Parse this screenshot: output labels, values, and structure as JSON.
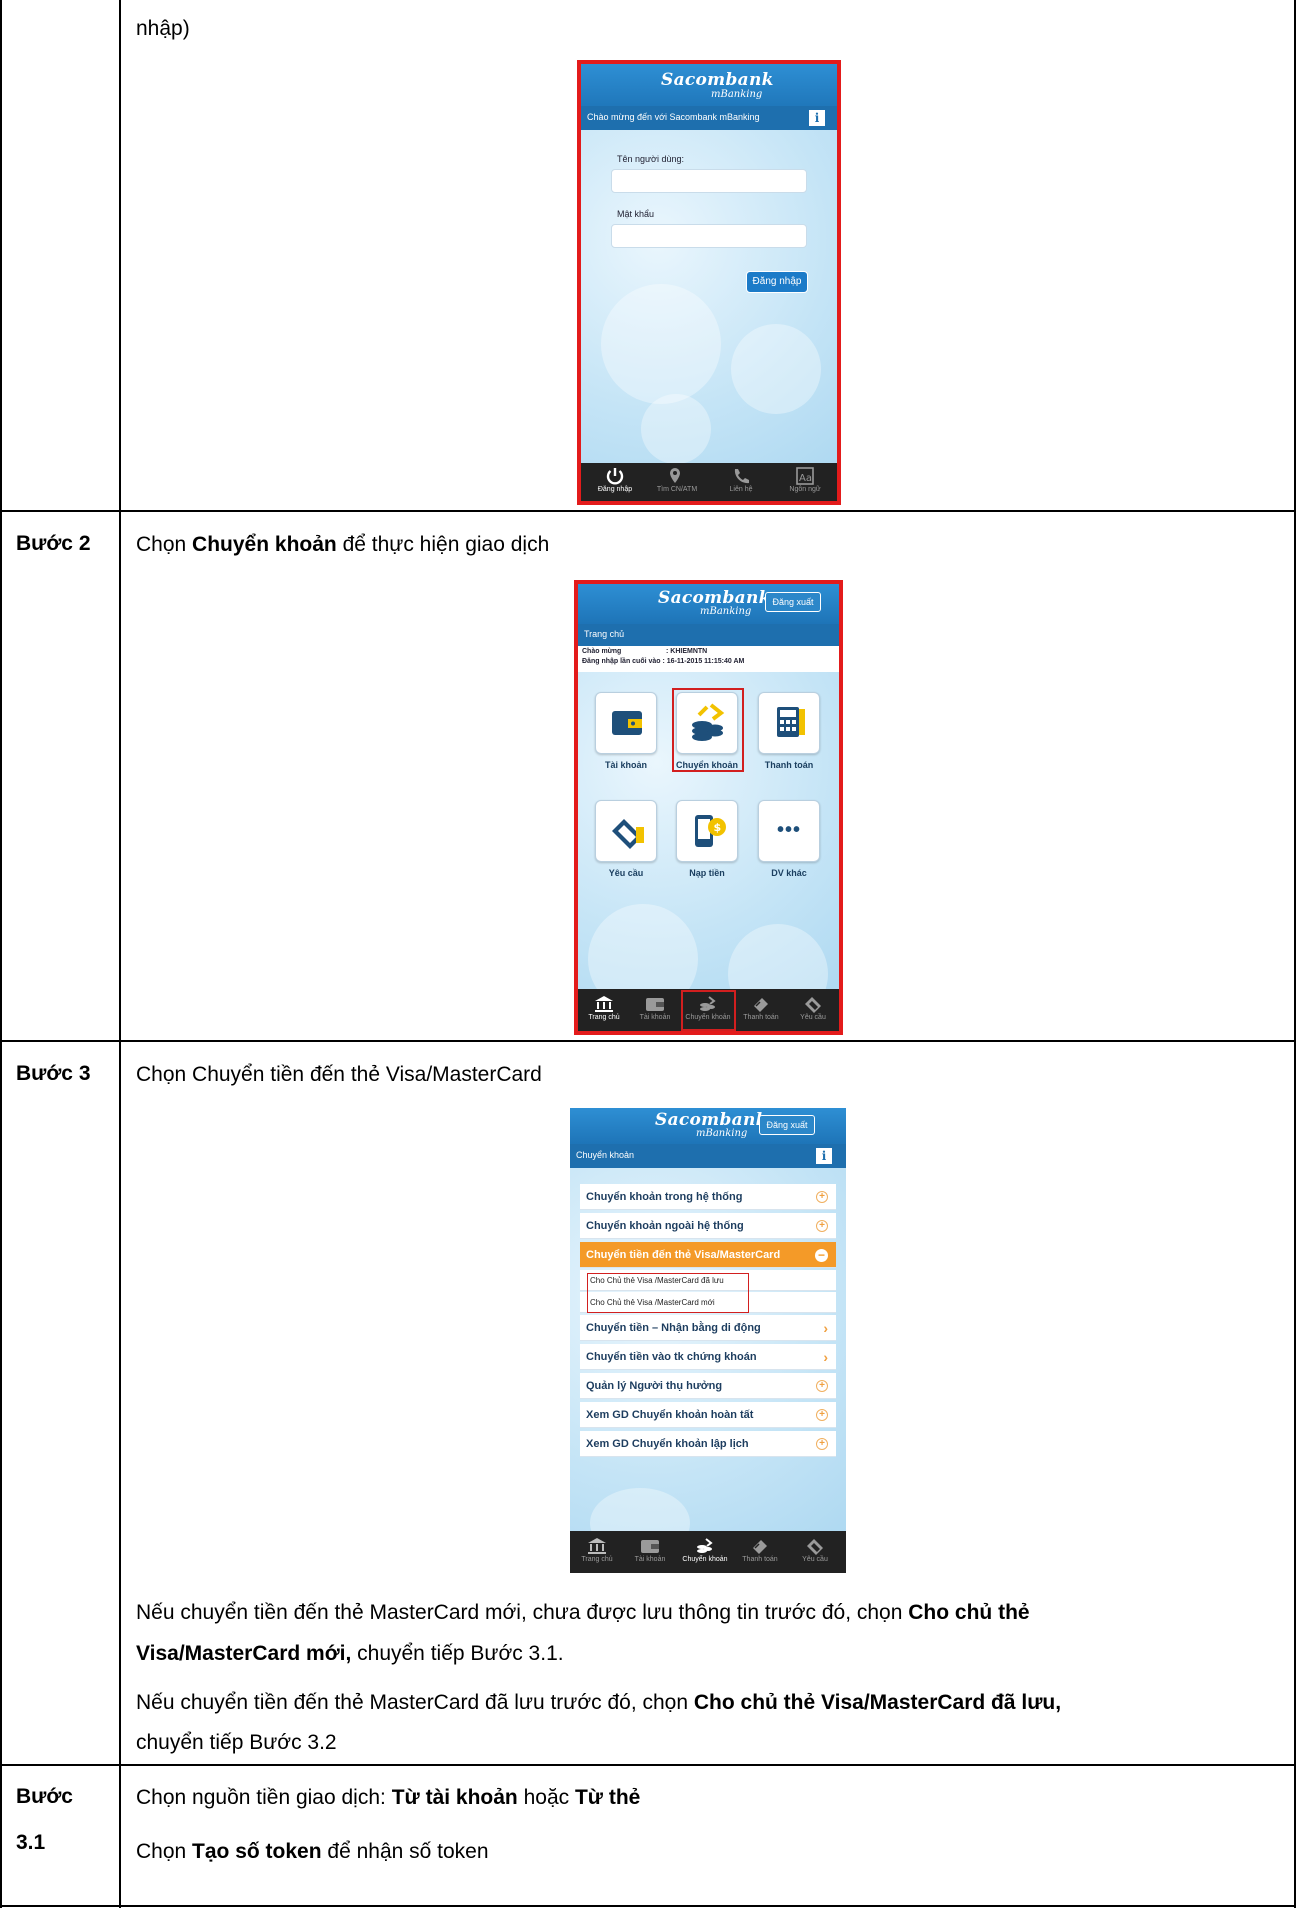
{
  "top_row": {
    "text_prefix": "nhập)",
    "phone": {
      "brand": "Sacombank",
      "brand_sub": "mBanking",
      "welcome_bar": "Chào mừng đến với Sacombank mBanking",
      "info_icon": "i",
      "username_label": "Tên người dùng:",
      "password_label": "Mật khẩu",
      "login_button": "Đăng nhập",
      "tabs": [
        {
          "label": "Đăng nhập",
          "icon": "power-icon"
        },
        {
          "label": "Tìm CN/ATM",
          "icon": "map-pin-icon"
        },
        {
          "label": "Liên hệ",
          "icon": "phone-icon"
        },
        {
          "label": "Ngôn ngữ",
          "icon": "language-icon"
        }
      ]
    }
  },
  "step2": {
    "label": "Bước 2",
    "instruction_prefix": "Chọn ",
    "instruction_bold": "Chuyển khoản",
    "instruction_suffix": " để thực hiện giao dịch",
    "phone": {
      "brand": "Sacombank",
      "brand_sub": "mBanking",
      "logout_button": "Đăng xuất",
      "page_bar": "Trang chủ",
      "greeting_line1": "Chào mừng                       : KHIEMNTN",
      "greeting_line2": "Đăng nhập lần cuối vào : 16-11-2015 11:15:40 AM",
      "tiles": [
        {
          "label": "Tài khoản",
          "icon": "wallet-icon"
        },
        {
          "label": "Chuyển khoản",
          "icon": "coins-transfer-icon"
        },
        {
          "label": "Thanh toán",
          "icon": "calculator-icon"
        },
        {
          "label": "Yêu cầu",
          "icon": "card-request-icon"
        },
        {
          "label": "Nạp tiền",
          "icon": "mobile-topup-icon"
        },
        {
          "label": "DV khác",
          "icon": "more-dots-icon"
        }
      ],
      "more_dots": "•••",
      "tabs": [
        {
          "label": "Trang chủ",
          "icon": "bank-icon"
        },
        {
          "label": "Tài khoản",
          "icon": "wallet-icon"
        },
        {
          "label": "Chuyển khoản",
          "icon": "transfer-icon"
        },
        {
          "label": "Thanh toán",
          "icon": "payment-icon"
        },
        {
          "label": "Yêu cầu",
          "icon": "request-icon"
        }
      ]
    }
  },
  "step3": {
    "label": "Bước 3",
    "instruction": "Chọn Chuyển tiền đến thẻ Visa/MasterCard",
    "phone": {
      "brand": "Sacombank",
      "brand_sub": "mBanking",
      "logout_button": "Đăng xuất",
      "page_bar": "Chuyển khoản",
      "info_icon": "i",
      "menu": [
        {
          "label": "Chuyển khoản trong hệ thống",
          "marker": "+"
        },
        {
          "label": "Chuyển khoản ngoài hệ thống",
          "marker": "+"
        },
        {
          "label": "Chuyển tiền đến thẻ Visa/MasterCard",
          "marker": "−"
        },
        {
          "label": "Cho Chủ thẻ Visa /MasterCard đã lưu",
          "marker": ""
        },
        {
          "label": "Cho Chủ thẻ Visa /MasterCard mới",
          "marker": ""
        },
        {
          "label": "Chuyển tiền – Nhận bằng di động",
          "marker": "›"
        },
        {
          "label": "Chuyển tiền vào tk chứng khoán",
          "marker": "›"
        },
        {
          "label": "Quản lý Người thụ hưởng",
          "marker": "+"
        },
        {
          "label": "Xem GD Chuyển khoản hoàn tất",
          "marker": "+"
        },
        {
          "label": "Xem GD Chuyển khoản lập lịch",
          "marker": "+"
        }
      ],
      "tabs": [
        {
          "label": "Trang chủ"
        },
        {
          "label": "Tài khoản"
        },
        {
          "label": "Chuyển khoản"
        },
        {
          "label": "Thanh toán"
        },
        {
          "label": "Yêu cầu"
        }
      ]
    },
    "note1_line1_prefix": "Nếu chuyển tiền đến thẻ MasterCard mới, chưa được lưu thông tin trước đó, chọn ",
    "note1_line1_bold": "Cho chủ thẻ",
    "note1_line2_bold": "Visa/MasterCard mới,",
    "note1_line2_suffix": " chuyển tiếp Bước 3.1.",
    "note2_line1_prefix": "Nếu chuyển tiền đến thẻ MasterCard đã lưu trước đó, chọn ",
    "note2_line1_bold": "Cho chủ thẻ Visa/MasterCard đã lưu,",
    "note2_line2": "chuyển tiếp Bước 3.2"
  },
  "step31": {
    "label_line1": "Bước",
    "label_line2": "3.1",
    "line1_prefix": "Chọn nguồn tiền giao dịch: ",
    "line1_bold1": "Từ tài khoản",
    "line1_mid": " hoặc ",
    "line1_bold2": "Từ thẻ",
    "line2_prefix": "Chọn ",
    "line2_bold": "Tạo số token",
    "line2_suffix": " để nhận số token"
  }
}
